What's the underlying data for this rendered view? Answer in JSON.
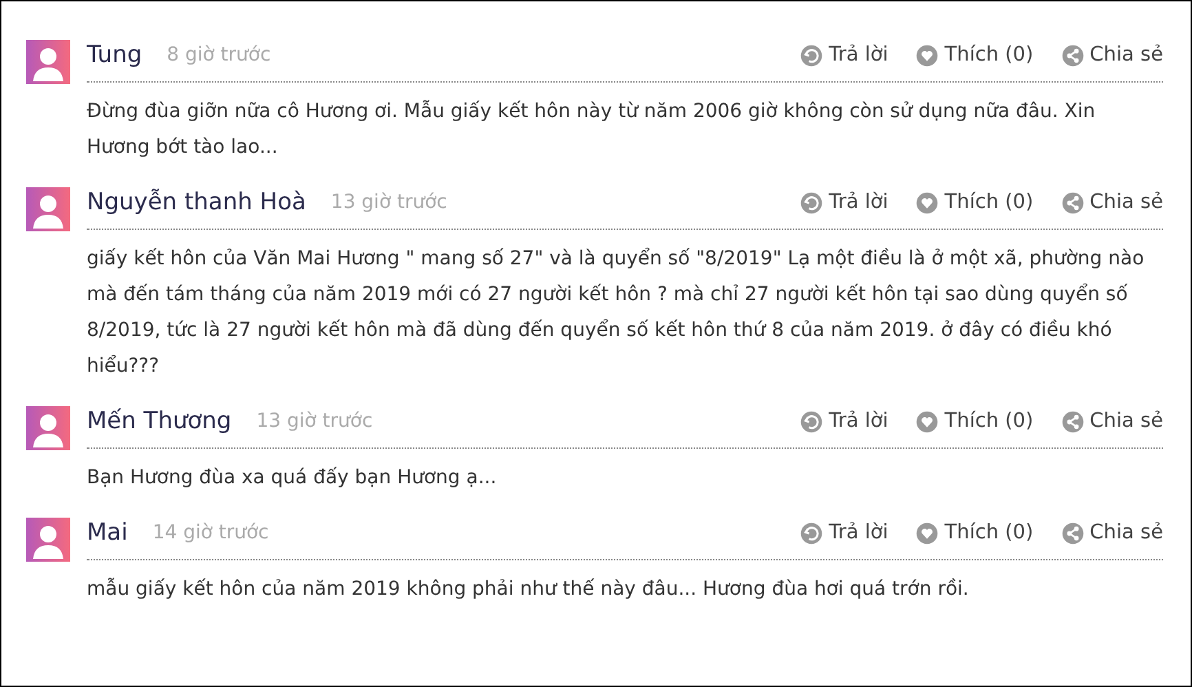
{
  "comments": [
    {
      "author": "Tung",
      "time": "8 giờ trước",
      "actions": {
        "reply": "Trả lời",
        "like": "Thích (0)",
        "share": "Chia sẻ"
      },
      "text": "Đừng đùa giỡn nữa cô Hương ơi. Mẫu giấy kết hôn này từ năm 2006 giờ không còn sử dụng nữa đâu. Xin Hương bớt tào lao..."
    },
    {
      "author": "Nguyễn thanh Hoà",
      "time": "13 giờ trước",
      "actions": {
        "reply": "Trả lời",
        "like": "Thích (0)",
        "share": "Chia sẻ"
      },
      "text": "giấy kết hôn của Văn Mai Hương \" mang số 27\" và là quyển số \"8/2019\" Lạ một điều là ở một xã, phường nào mà đến tám tháng của năm 2019 mới có 27 người kết hôn ? mà chỉ 27 người kết hôn tại sao dùng quyển số 8/2019, tức là 27 người kết hôn mà đã dùng đến quyển số kết hôn thứ 8 của năm 2019. ở đây có điều khó hiểu???"
    },
    {
      "author": "Mến Thương",
      "time": "13 giờ trước",
      "actions": {
        "reply": "Trả lời",
        "like": "Thích (0)",
        "share": "Chia sẻ"
      },
      "text": "Bạn Hương đùa xa quá đấy bạn Hương ạ..."
    },
    {
      "author": "Mai",
      "time": "14 giờ trước",
      "actions": {
        "reply": "Trả lời",
        "like": "Thích (0)",
        "share": "Chia sẻ"
      },
      "text": "mẫu giấy kết hôn của năm 2019 không phải như thế này đâu... Hương đùa hơi quá trớn rồi."
    }
  ]
}
